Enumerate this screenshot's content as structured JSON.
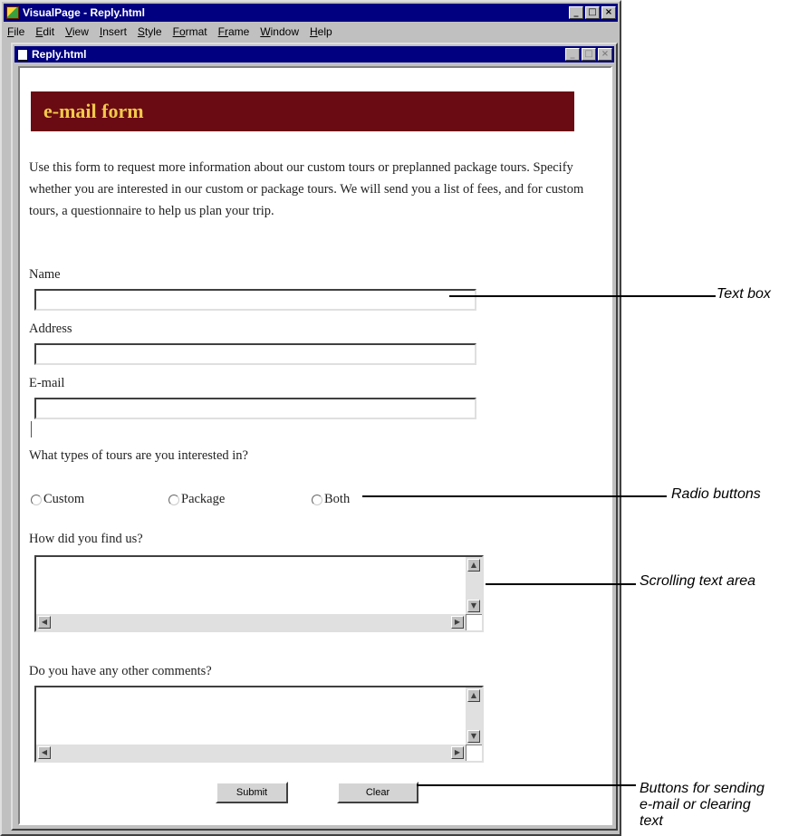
{
  "app": {
    "title": "VisualPage - Reply.html",
    "menu": [
      {
        "underline": "F",
        "rest": "ile"
      },
      {
        "underline": "E",
        "rest": "dit"
      },
      {
        "underline": "V",
        "rest": "iew"
      },
      {
        "underline": "I",
        "rest": "nsert"
      },
      {
        "underline": "S",
        "rest": "tyle"
      },
      {
        "underline": "Fo",
        "rest": "rmat"
      },
      {
        "underline": "Fr",
        "rest": "ame"
      },
      {
        "underline": "W",
        "rest": "indow"
      },
      {
        "underline": "H",
        "rest": "elp"
      }
    ]
  },
  "doc": {
    "title": "Reply.html"
  },
  "page": {
    "heading": "e-mail form",
    "intro": "Use this form to request more information about our custom tours or preplanned package tours. Specify whether you are interested in our custom or package tours. We will send you a list of fees, and for custom tours, a questionnaire to help us plan your trip.",
    "fields": {
      "name_label": "Name",
      "address_label": "Address",
      "email_label": "E-mail"
    },
    "tour_question": "What types of tours are you interested in?",
    "radios": [
      "Custom",
      "Package",
      "Both"
    ],
    "find_question": "How did you find us?",
    "comments_question": "Do you have any other comments?",
    "buttons": {
      "submit": "Submit",
      "clear": "Clear"
    }
  },
  "callouts": {
    "text_box": "Text box",
    "radio_buttons": "Radio buttons",
    "scrolling_text_area": "Scrolling text area",
    "buttons": [
      "Buttons for sending",
      "e-mail or clearing",
      "text"
    ]
  }
}
